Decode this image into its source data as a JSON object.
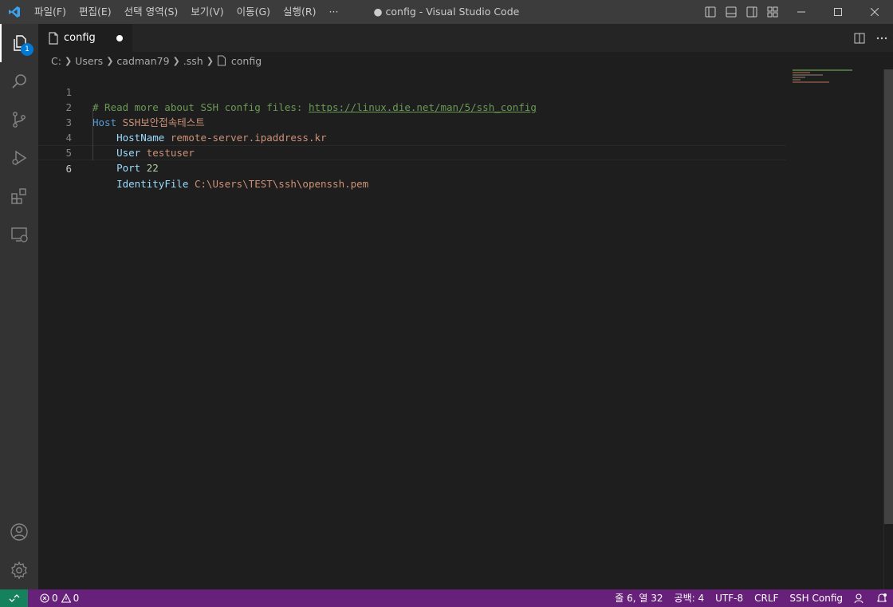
{
  "window": {
    "title": "● config - Visual Studio Code"
  },
  "menu": [
    {
      "label": "파일(F)"
    },
    {
      "label": "편집(E)"
    },
    {
      "label": "선택 영역(S)"
    },
    {
      "label": "보기(V)"
    },
    {
      "label": "이동(G)"
    },
    {
      "label": "실행(R)"
    },
    {
      "label": "···"
    }
  ],
  "activity": {
    "explorer_badge": "1"
  },
  "tab": {
    "label": "config",
    "dirty": true
  },
  "breadcrumb": [
    "C:",
    "Users",
    "cadman79",
    ".ssh",
    "config"
  ],
  "editor": {
    "line_numbers": [
      "1",
      "2",
      "3",
      "4",
      "5",
      "6"
    ],
    "lines": [
      {
        "comment": "# Read more about SSH config files: ",
        "link": "https://linux.die.net/man/5/ssh_config"
      },
      {
        "keyword": "Host",
        "value": "SSH보안접속테스트"
      },
      {
        "indent": "    ",
        "keyword": "HostName",
        "value": "remote-server.ipaddress.kr"
      },
      {
        "indent": "    ",
        "keyword": "User",
        "value": "testuser"
      },
      {
        "indent": "    ",
        "keyword": "Port",
        "value": "22"
      },
      {
        "indent": "    ",
        "keyword": "IdentityFile",
        "value": "C:\\Users\\TEST\\ssh\\openssh.pem"
      }
    ],
    "current_line": 6
  },
  "status": {
    "errors": "0",
    "warnings": "0",
    "position": "줄 6, 열 32",
    "indent": "공백: 4",
    "encoding": "UTF-8",
    "eol": "CRLF",
    "language": "SSH Config"
  },
  "colors": {
    "statusbar": "#68217a",
    "remote": "#16825d",
    "accent": "#0078d4"
  }
}
